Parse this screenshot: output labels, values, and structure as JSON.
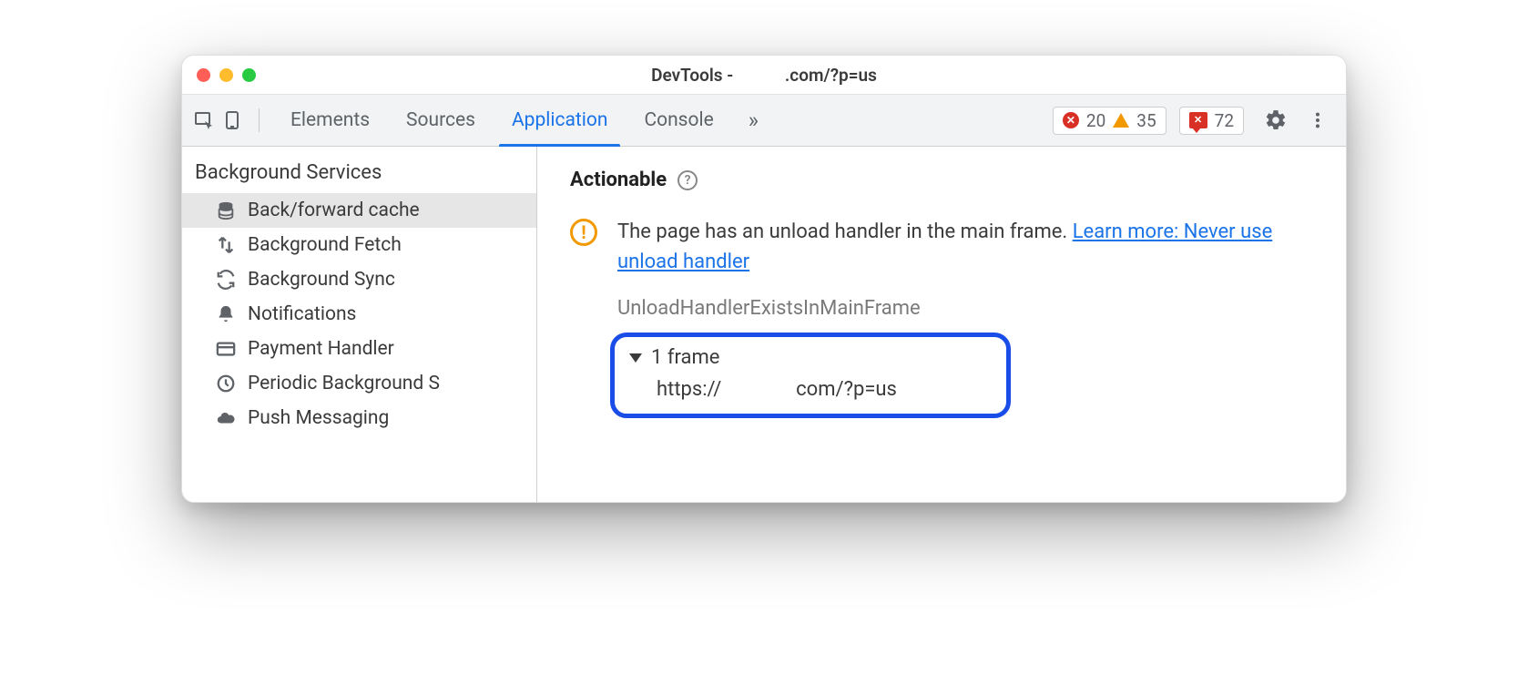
{
  "window": {
    "title_prefix": "DevTools -",
    "title_url": ".com/?p=us"
  },
  "toolbar": {
    "tabs": [
      {
        "label": "Elements"
      },
      {
        "label": "Sources"
      },
      {
        "label": "Application"
      },
      {
        "label": "Console"
      }
    ],
    "active_tab_index": 2,
    "errors_count": "20",
    "warnings_count": "35",
    "issues_count": "72"
  },
  "sidebar": {
    "section_title": "Background Services",
    "items": [
      {
        "label": "Back/forward cache",
        "icon": "database-icon",
        "selected": true
      },
      {
        "label": "Background Fetch",
        "icon": "transfer-icon"
      },
      {
        "label": "Background Sync",
        "icon": "sync-icon"
      },
      {
        "label": "Notifications",
        "icon": "bell-icon"
      },
      {
        "label": "Payment Handler",
        "icon": "card-icon"
      },
      {
        "label": "Periodic Background S",
        "icon": "clock-icon"
      },
      {
        "label": "Push Messaging",
        "icon": "cloud-icon"
      }
    ]
  },
  "main": {
    "section_title": "Actionable",
    "message_text": "The page has an unload handler in the main frame. ",
    "link_text": "Learn more: Never use unload handler",
    "reason_name": "UnloadHandlerExistsInMainFrame",
    "frames": {
      "summary": "1 frame",
      "url_prefix": "https://",
      "url_suffix": "com/?p=us"
    }
  }
}
